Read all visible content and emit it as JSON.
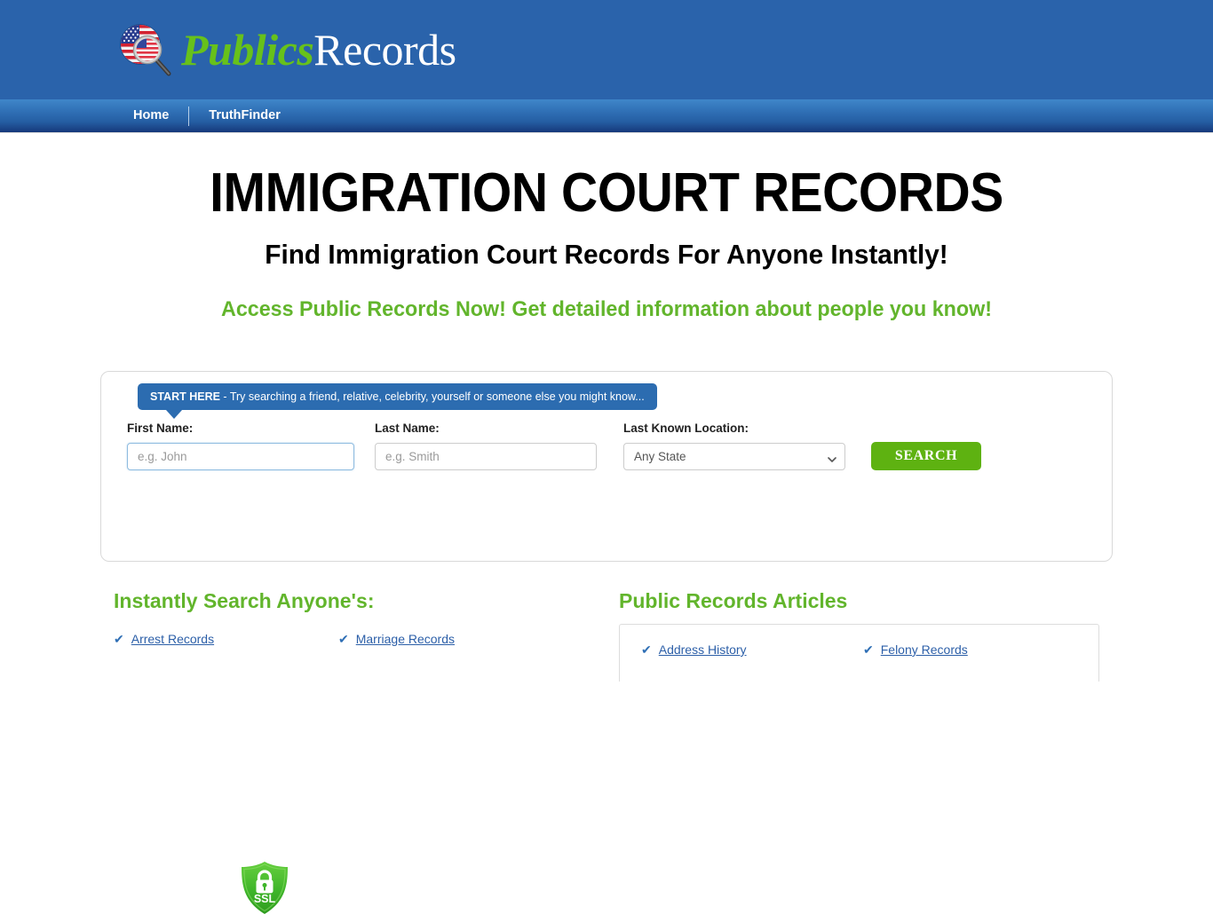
{
  "header": {
    "logo": {
      "icon": "flag-magnifier-icon",
      "text_primary": "Publics",
      "text_secondary": "Records"
    }
  },
  "nav": {
    "items": [
      {
        "label": "Home"
      },
      {
        "label": "TruthFinder"
      }
    ]
  },
  "hero": {
    "title": "IMMIGRATION COURT RECORDS",
    "subtitle": "Find Immigration Court Records For Anyone Instantly!",
    "tagline": "Access Public Records Now! Get detailed information about people you know!",
    "tagline_color": "#62b52c"
  },
  "search": {
    "tooltip_strong": "START HERE",
    "tooltip_rest": " - Try searching a friend, relative, celebrity, yourself or someone else you might know...",
    "first_name": {
      "label": "First Name:",
      "placeholder": "e.g. John",
      "value": ""
    },
    "last_name": {
      "label": "Last Name:",
      "placeholder": "e.g. Smith",
      "value": ""
    },
    "location": {
      "label": "Last Known Location:",
      "selected": "Any State",
      "options": [
        "Any State"
      ]
    },
    "submit_label": "SEARCH",
    "submit_color": "#5eb211",
    "ssl_badge": {
      "icon": "ssl-shield-lock-icon",
      "label": "SSL",
      "color": "#4cbb30"
    }
  },
  "lower": {
    "left": {
      "title": "Instantly Search Anyone's:",
      "links": [
        {
          "label": "Arrest Records"
        },
        {
          "label": "Marriage Records"
        }
      ]
    },
    "right": {
      "title": "Public Records Articles",
      "links": [
        {
          "label": "Address History"
        },
        {
          "label": "Felony Records"
        }
      ]
    }
  }
}
